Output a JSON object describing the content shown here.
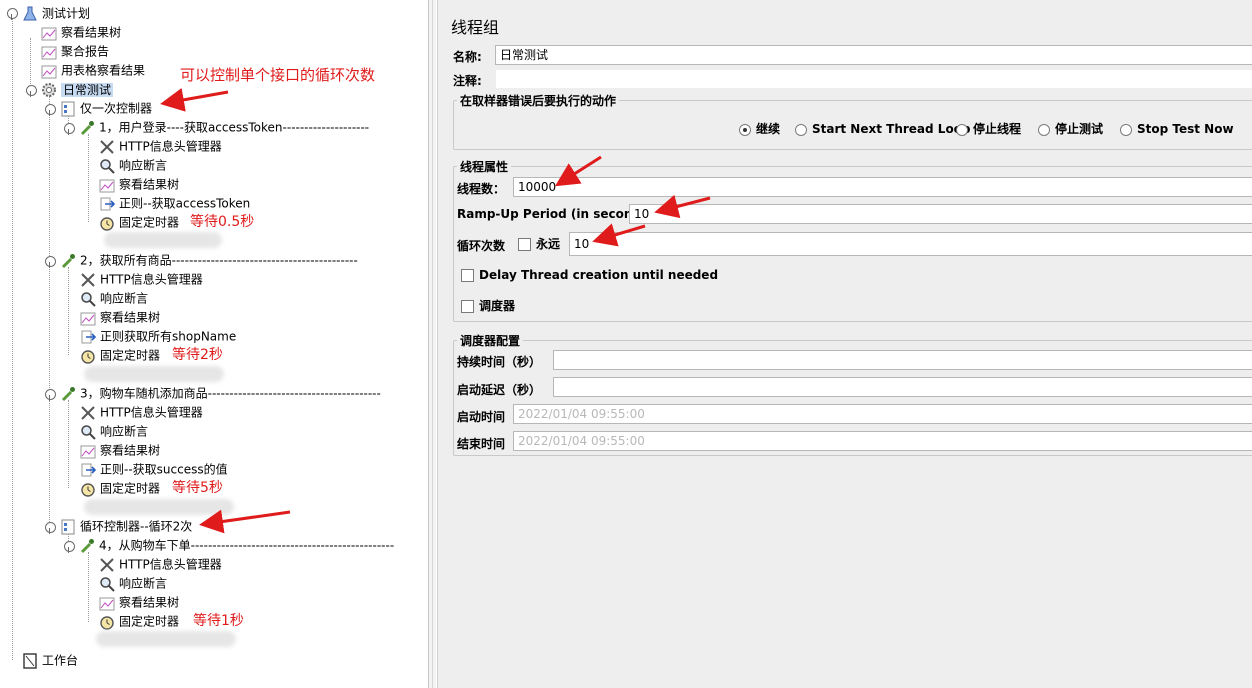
{
  "tree": {
    "root": "测试计划",
    "listener_view_results": "察看结果树",
    "listener_aggregate": "聚合报告",
    "listener_table": "用表格察看结果",
    "thread_group": "日常测试",
    "once_controller": "仅一次控制器",
    "sampler1": "1，用户登录----获取accessToken--------------------",
    "s1_header": "HTTP信息头管理器",
    "s1_assert": "响应断言",
    "s1_view": "察看结果树",
    "s1_regex": "正则--获取accessToken",
    "s1_timer": "固定定时器",
    "sampler2": "2，获取所有商品-------------------------------------------",
    "s2_header": "HTTP信息头管理器",
    "s2_assert": "响应断言",
    "s2_view": "察看结果树",
    "s2_regex": "正则获取所有shopName",
    "s2_timer": "固定定时器",
    "sampler3": "3，购物车随机添加商品----------------------------------------",
    "s3_header": "HTTP信息头管理器",
    "s3_assert": "响应断言",
    "s3_view": "察看结果树",
    "s3_regex": "正则--获取success的值",
    "s3_timer": "固定定时器",
    "loop_controller": "循环控制器--循环2次",
    "sampler4": "4，从购物车下单-----------------------------------------------",
    "s4_header": "HTTP信息头管理器",
    "s4_assert": "响应断言",
    "s4_view": "察看结果树",
    "s4_timer": "固定定时器",
    "workbench": "工作台"
  },
  "annotations": {
    "once_note": "可以控制单个接口的循环次数",
    "wait1": "等待0.5秒",
    "wait2": "等待2秒",
    "wait3": "等待5秒",
    "wait4": "等待1秒"
  },
  "panel": {
    "title": "线程组",
    "name_label": "名称:",
    "name_value": "日常测试",
    "comment_label": "注释:",
    "comment_value": "",
    "error_group_title": "在取样器错误后要执行的动作",
    "error_options": [
      "继续",
      "Start Next Thread Loop",
      "停止线程",
      "停止测试",
      "Stop Test Now"
    ],
    "error_selected_index": 0,
    "thread_props_title": "线程属性",
    "threads_label": "线程数：",
    "threads_value": "10000",
    "rampup_label": "Ramp-Up Period (in seconds):",
    "rampup_value": "10",
    "loop_label": "循环次数",
    "forever_label": "永远",
    "loop_value": "10",
    "delay_label": "Delay Thread creation until needed",
    "scheduler_label": "调度器",
    "scheduler_config_title": "调度器配置",
    "duration_label": "持续时间（秒）",
    "duration_value": "",
    "startup_delay_label": "启动延迟（秒）",
    "startup_delay_value": "",
    "start_time_label": "启动时间",
    "start_time_value": "2022/01/04 09:55:00",
    "end_time_label": "结束时间",
    "end_time_value": "2022/01/04 09:55:00"
  },
  "colors": {
    "annotation": "#e01b1b",
    "selection": "#c6daf1",
    "panel_bg": "#eeeeee"
  }
}
